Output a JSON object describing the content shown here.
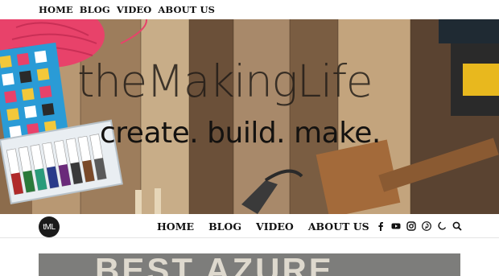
{
  "top_nav": {
    "links": [
      "HOME",
      "BLOG",
      "VIDEO",
      "ABOUT US"
    ]
  },
  "hero": {
    "title": "theMakingLife",
    "tagline": "create. build. make."
  },
  "main_nav": {
    "logo_text": "tML",
    "links": [
      "HOME",
      "BLOG",
      "VIDEO",
      "ABOUT US"
    ],
    "icons": [
      "facebook-icon",
      "youtube-icon",
      "instagram-icon",
      "pinterest-icon",
      "moon-icon",
      "search-icon"
    ]
  },
  "featured": {
    "title": "BEST AZURE"
  },
  "colors": {
    "wood_dark": "#5e4632",
    "wood_light": "#c4a680",
    "nav_text": "#111111",
    "accent_pink": "#e8426a"
  }
}
